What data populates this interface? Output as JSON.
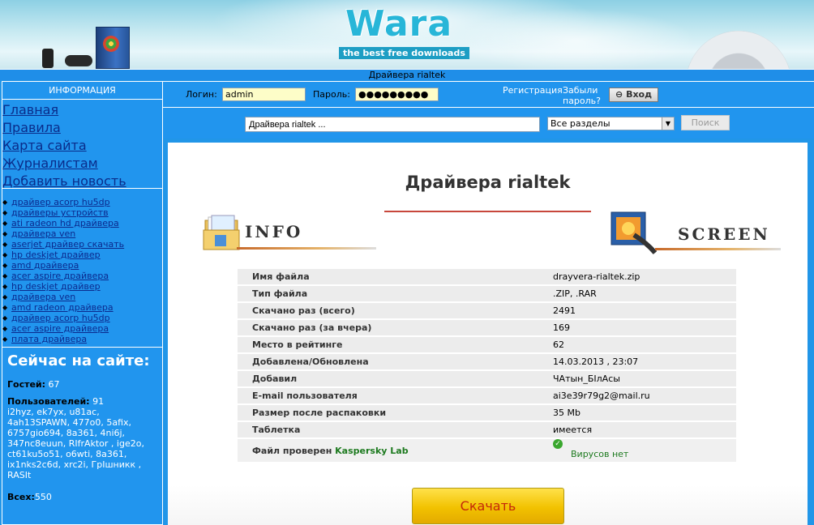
{
  "header": {
    "logo": "Wara",
    "tagline": "the best free downloads",
    "page_title_bar": "Драйвера rialtek"
  },
  "sidebar": {
    "heading": "ИНФОРМАЦИЯ",
    "nav": [
      "Главная",
      "Правила",
      "Карта сайта",
      "Журналистам",
      "Добавить новость"
    ],
    "tags": [
      "драйвер acorp hu5dp",
      "драйверы устройств",
      "ati radeon hd драйвера",
      "драйвера ven",
      "aserjet драйвер скачать",
      "hp deskjet драйвер",
      "amd драйвера",
      "acer aspire драйвера",
      "hp deskjet драйвер",
      "драйвера ven",
      "amd radeon драйвера",
      "драйвер acorp hu5dp",
      "acer aspire драйвера",
      "плата драйвера"
    ],
    "online": {
      "title": "Сейчас на сайте:",
      "guests_label": "Гостей:",
      "guests_value": "67",
      "users_label": "Пользователей:",
      "users_value": "91",
      "users_list": "i2hyz, ek7yx, u81ac, 4ah13SPAWN, 477o0, 5afix, 6757gio694, 8a361, 4ni6j, 347nc8euun, RIfrAktor , ige2o, ct61ku5o51, o6wti, 8a361, ix1nks2c6d, xrc2i, ГрIшникк , RASIt",
      "total_label": "Всех:",
      "total_value": "550"
    }
  },
  "login": {
    "login_label": "Логин:",
    "login_value": "admin",
    "password_label": "Пароль:",
    "password_value": "●●●●●●●●●",
    "enter_button": "Вход",
    "register_link": "Регистрация",
    "forgot_link_1": "Забыли",
    "forgot_link_2": "пароль?"
  },
  "search": {
    "query": "Драйвера rialtek ...",
    "section": "Все разделы",
    "button": "Поиск"
  },
  "main": {
    "title": "Драйвера rialtek",
    "info_banner": "INFO",
    "screen_banner": "SCREEN",
    "rows": [
      {
        "label": "Имя файла",
        "value": "drayvera-rialtek.zip"
      },
      {
        "label": "Тип файла",
        "value": ".ZIP, .RAR"
      },
      {
        "label": "Скачано раз (всего)",
        "value": "2491"
      },
      {
        "label": "Скачано раз (за вчера)",
        "value": "169"
      },
      {
        "label": "Место в рейтинге",
        "value": "62"
      },
      {
        "label": "Добавлена/Обновлена",
        "value": "14.03.2013 , 23:07"
      },
      {
        "label": "Добавил",
        "value": "ЧАтын_БIлАсы"
      },
      {
        "label": "E-mail пользователя",
        "value": "ai3e39r79g2@mail.ru"
      },
      {
        "label": "Размер после распаковки",
        "value": "35  Mb"
      },
      {
        "label": "Таблетка",
        "value": "имеется"
      }
    ],
    "checked_label": "Файл проверен",
    "checked_by": "Kaspersky Lab",
    "virus_status": "Вирусов нет",
    "download_button": "Скачать"
  }
}
